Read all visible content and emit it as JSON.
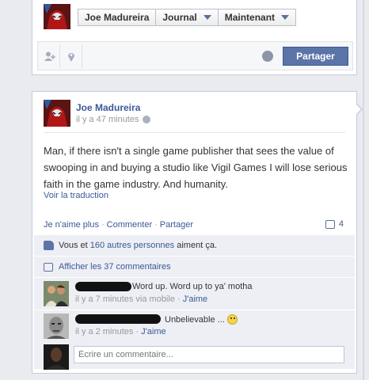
{
  "composer": {
    "user_name": "Joe Madureira",
    "audience_label": "Journal",
    "time_label": "Maintenant",
    "share_label": "Partager",
    "tool_icons": [
      "add-person-icon",
      "location-pin-icon"
    ],
    "privacy_icon": "globe-icon"
  },
  "post": {
    "author": "Joe Madureira",
    "timestamp": "il y a 47 minutes",
    "body": "Man, if there isn't a single game publisher that sees the value of swooping in and buying a studio like Vigil Games I will lose serious faith in the game industry. And humanity.",
    "translate_link": "Voir la traduction",
    "actions": {
      "unlike": "Je n'aime plus",
      "comment": "Commenter",
      "share": "Partager",
      "comment_count": "4"
    },
    "likes": {
      "prefix": "Vous et",
      "link": "160 autres personnes",
      "suffix": "aiment ça."
    },
    "view_all_comments": "Afficher les 37 commentaires",
    "comments": [
      {
        "text": "Word up. Word up to ya' motha",
        "meta": "il y a 7 minutes via mobile",
        "like_label": "J'aime"
      },
      {
        "text": "Unbelievable ...",
        "meta": "il y a 2 minutes",
        "like_label": "J'aime"
      }
    ],
    "write_comment_placeholder": "Écrire un commentaire..."
  },
  "colors": {
    "link_blue": "#3b5998",
    "button_blue": "#5b74a8",
    "comment_bg": "#edeff4",
    "page_bg": "#e9ebee"
  }
}
